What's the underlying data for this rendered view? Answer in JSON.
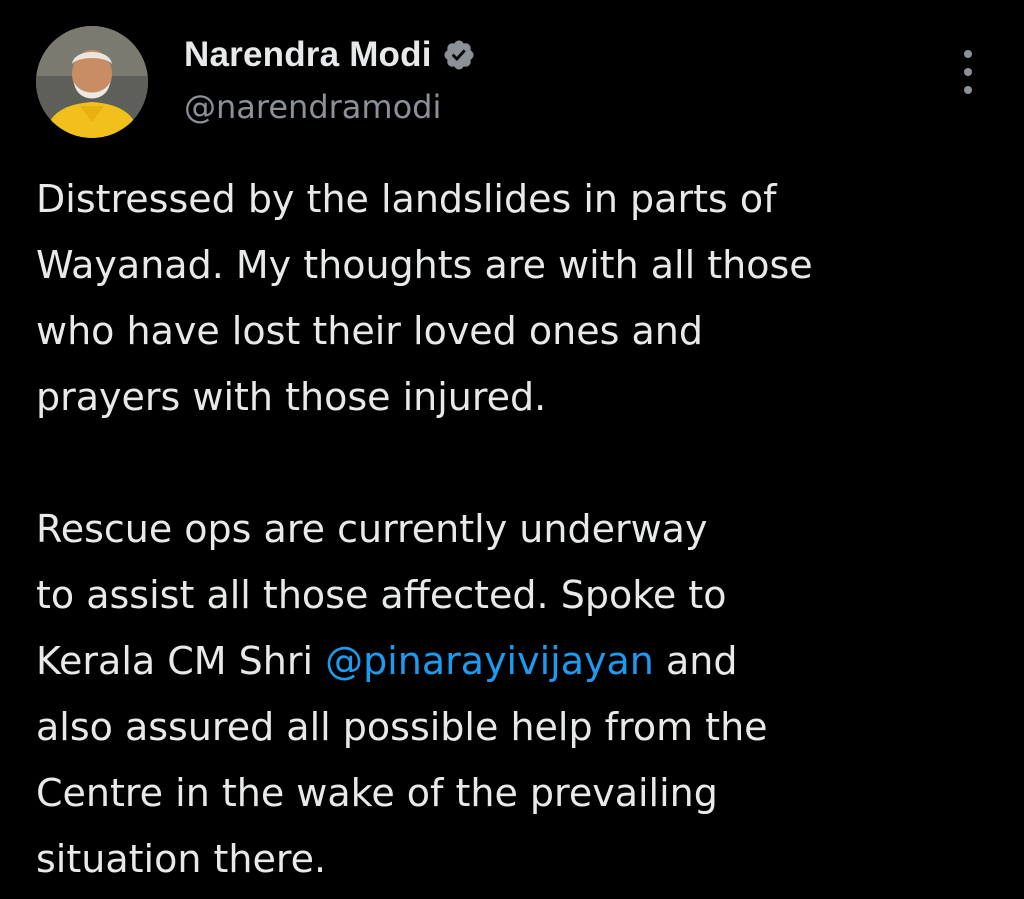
{
  "author": {
    "display_name": "Narendra Modi",
    "handle": "@narendramodi",
    "verified": true
  },
  "tweet": {
    "paragraph1": {
      "line1": "Distressed by the landslides in parts of",
      "line2": "Wayanad. My thoughts are with all those",
      "line3": "who have lost their loved ones and",
      "line4": "prayers with those injured."
    },
    "paragraph2": {
      "line1": "Rescue ops are currently underway",
      "line2": "to assist all those affected. Spoke to",
      "line3_before": "Kerala CM Shri ",
      "line3_mention": "@pinarayivijayan",
      "line3_after": " and",
      "line4": "also assured all possible help from the",
      "line5": "Centre in the wake of the prevailing",
      "line6": "situation there."
    }
  },
  "icons": {
    "verified": "verified-badge-icon",
    "more": "more-vertical-icon"
  },
  "colors": {
    "background": "#000000",
    "text": "#e7e9ea",
    "secondary": "#8b9197",
    "link": "#1d9bf0",
    "verified_badge": "#8b9197"
  }
}
